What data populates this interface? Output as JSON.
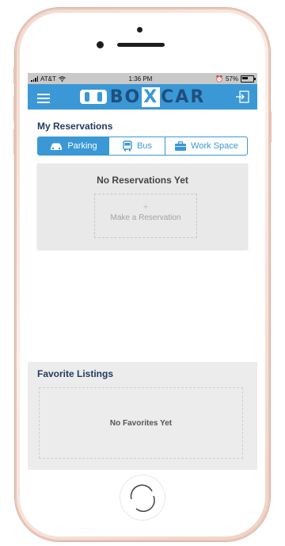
{
  "status_bar": {
    "carrier": "AT&T",
    "time": "1:36 PM",
    "battery": "57%"
  },
  "app_bar": {
    "brand_prefix": "BO",
    "brand_x": "X",
    "brand_suffix": "CAR",
    "color": "#3b98d6"
  },
  "reservations": {
    "title": "My Reservations",
    "tabs": [
      {
        "label": "Parking",
        "icon": "car-icon",
        "active": true
      },
      {
        "label": "Bus",
        "icon": "bus-icon",
        "active": false
      },
      {
        "label": "Work Space",
        "icon": "briefcase-icon",
        "active": false
      }
    ],
    "empty_heading": "No Reservations Yet",
    "make_plus": "+",
    "make_label": "Make a Reservation"
  },
  "favorites": {
    "title": "Favorite Listings",
    "empty_text": "No Favorites Yet"
  }
}
